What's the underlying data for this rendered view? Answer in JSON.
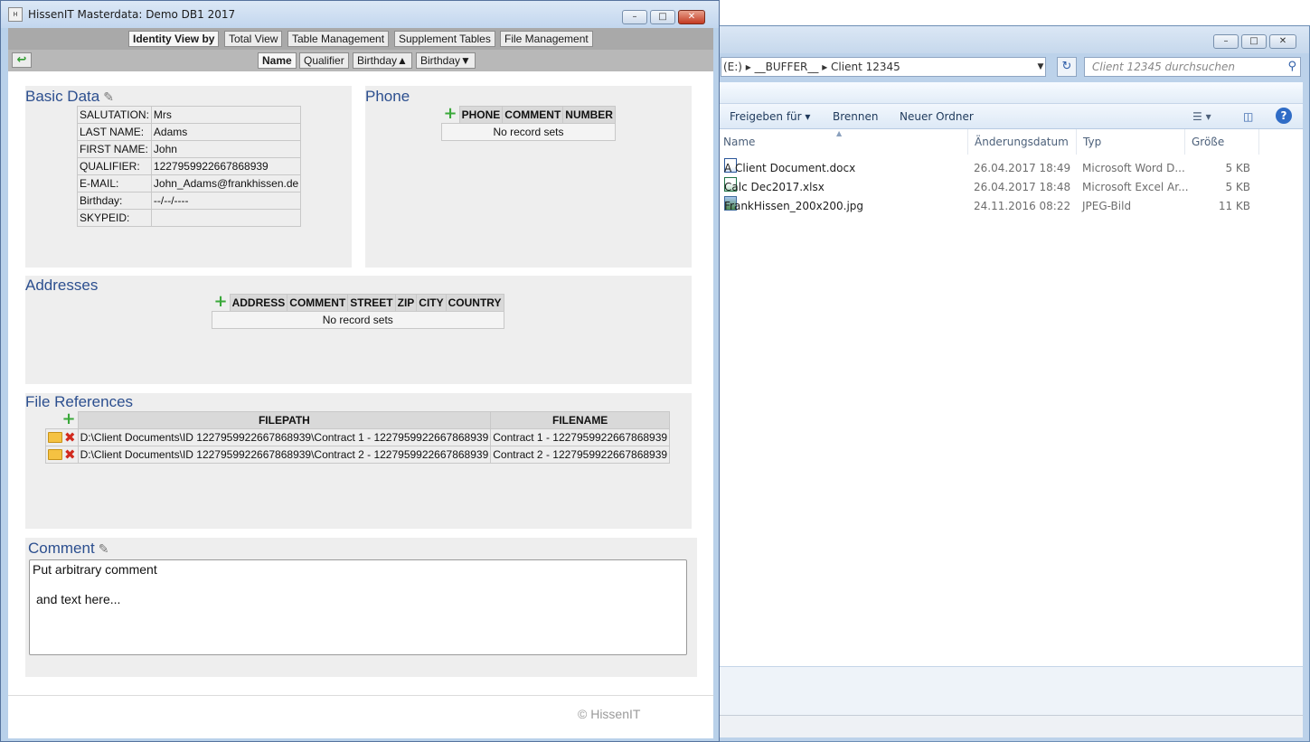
{
  "app": {
    "title": "HissenIT Masterdata: Demo DB1 2017",
    "icon_text": "H",
    "nav": {
      "identity_view_by": "Identity View by",
      "total_view": "Total View",
      "table_management": "Table Management",
      "supplement_tables": "Supplement Tables",
      "file_management": "File Management"
    },
    "sort": {
      "name": "Name",
      "qualifier": "Qualifier",
      "birthday_up": "Birthday▲",
      "birthday_down": "Birthday▼"
    },
    "basic_data": {
      "title": "Basic Data",
      "rows": [
        {
          "label": "SALUTATION:",
          "value": "Mrs"
        },
        {
          "label": "LAST NAME:",
          "value": "Adams"
        },
        {
          "label": "FIRST NAME:",
          "value": "John"
        },
        {
          "label": "QUALIFIER:",
          "value": "1227959922667868939"
        },
        {
          "label": "E-MAIL:",
          "value": "John_Adams@frankhissen.de"
        },
        {
          "label": "Birthday:",
          "value": "--/--/----"
        },
        {
          "label": "SKYPEID:",
          "value": ""
        }
      ]
    },
    "phone": {
      "title": "Phone",
      "headers": [
        "PHONE",
        "COMMENT",
        "NUMBER"
      ],
      "empty": "No record sets"
    },
    "addresses": {
      "title": "Addresses",
      "headers": [
        "ADDRESS",
        "COMMENT",
        "STREET",
        "ZIP",
        "CITY",
        "COUNTRY"
      ],
      "empty": "No record sets"
    },
    "file_references": {
      "title": "File References",
      "headers": [
        "FILEPATH",
        "FILENAME"
      ],
      "rows": [
        {
          "filepath": "D:\\Client Documents\\ID 1227959922667868939\\Contract 1 - 1227959922667868939",
          "filename": "Contract 1 - 1227959922667868939"
        },
        {
          "filepath": "D:\\Client Documents\\ID 1227959922667868939\\Contract 2 - 1227959922667868939",
          "filename": "Contract 2 - 1227959922667868939"
        }
      ]
    },
    "comment": {
      "title": "Comment",
      "line1": "Put arbitrary comment",
      "line2": "and text here..."
    },
    "copyright": "© HissenIT"
  },
  "explorer": {
    "address": "(E:)  ▸  __BUFFER__  ▸  Client 12345",
    "search_placeholder": "Client 12345 durchsuchen",
    "toolbar": {
      "share": "Freigeben für ▾",
      "burn": "Brennen",
      "new_folder": "Neuer Ordner"
    },
    "columns": {
      "name": "Name",
      "date": "Änderungsdatum",
      "type": "Typ",
      "size": "Größe"
    },
    "files": [
      {
        "name": "A Client Document.docx",
        "date": "26.04.2017 18:49",
        "type": "Microsoft Word D...",
        "size": "5 KB",
        "icon": "word-doc-icon"
      },
      {
        "name": "Calc Dec2017.xlsx",
        "date": "26.04.2017 18:48",
        "type": "Microsoft Excel Ar...",
        "size": "5 KB",
        "icon": "excel-doc-icon"
      },
      {
        "name": "FrankHissen_200x200.jpg",
        "date": "24.11.2016 08:22",
        "type": "JPEG-Bild",
        "size": "11 KB",
        "icon": "image-file-icon"
      }
    ]
  },
  "colors": {
    "panel_title": "#2c4f8f",
    "plus_green": "#3aa83a",
    "delete_red": "#d12a1e",
    "nav_bar_gray": "#a9a9a9"
  }
}
